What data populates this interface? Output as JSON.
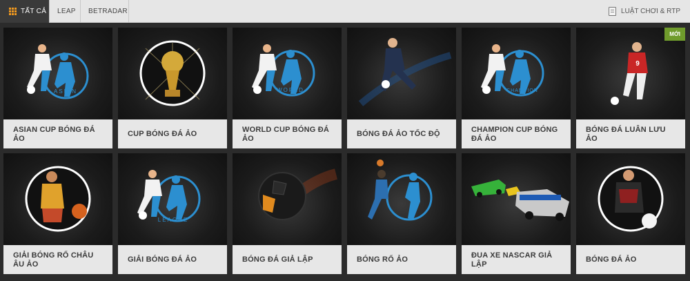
{
  "tabs": {
    "all": "TẤT CẢ",
    "leap": "LEAP",
    "betradar": "BETRADAR",
    "rules": "LUẬT CHƠI & RTP"
  },
  "badge": "MỚI",
  "art_text": {
    "asian": "ASIAN",
    "world": "WORLD",
    "champion": "CHAMPION",
    "league": "LEAGUE",
    "jersey_number": "9"
  },
  "games": [
    "ASIAN CUP BÓNG ĐÁ ẢO",
    "CUP BÓNG ĐÁ ẢO",
    "WORLD CUP BÓNG ĐÁ ẢO",
    "BÓNG ĐÁ ẢO TỐC ĐỘ",
    "CHAMPION CUP BÓNG ĐÁ ẢO",
    "BÓNG ĐÁ LUÂN LƯU ẢO",
    "GIẢI BÓNG RỔ CHÂU ÂU ẢO",
    "GIẢI BÓNG ĐÁ ẢO",
    "BÓNG ĐÁ GIẢ LẬP",
    "BÓNG RỔ ẢO",
    "ĐUA XE NASCAR GIẢ LẬP",
    "BÓNG ĐÁ ẢO"
  ]
}
